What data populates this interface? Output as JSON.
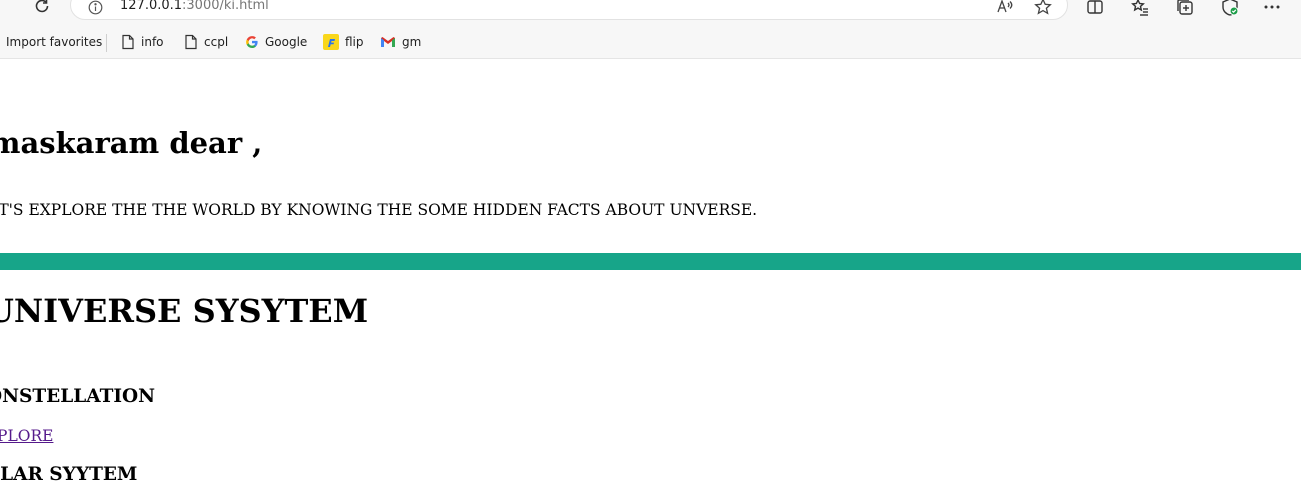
{
  "browser": {
    "url_host": "127.0.0.1",
    "url_rest": ":3000/ki.html",
    "favorites": [
      {
        "label": "Import favorites",
        "icon": "none"
      },
      {
        "label": "info",
        "icon": "page-icon"
      },
      {
        "label": "ccpl",
        "icon": "page-icon"
      },
      {
        "label": "Google",
        "icon": "google-icon"
      },
      {
        "label": "flip",
        "icon": "flipkart-icon"
      },
      {
        "label": "gm",
        "icon": "gmail-icon"
      }
    ]
  },
  "page": {
    "greeting": "amaskaram dear ,",
    "intro": "ET'S EXPLORE THE THE WORLD BY KNOWING THE SOME HIDDEN FACTS ABOUT UNVERSE.",
    "divider_color": "#17a589",
    "heading": "UNIVERSE SYSYTEM",
    "sections": [
      {
        "title": "ONSTELLATION",
        "link": "XPLORE"
      },
      {
        "title": "OLAR SYYTEM"
      }
    ]
  }
}
